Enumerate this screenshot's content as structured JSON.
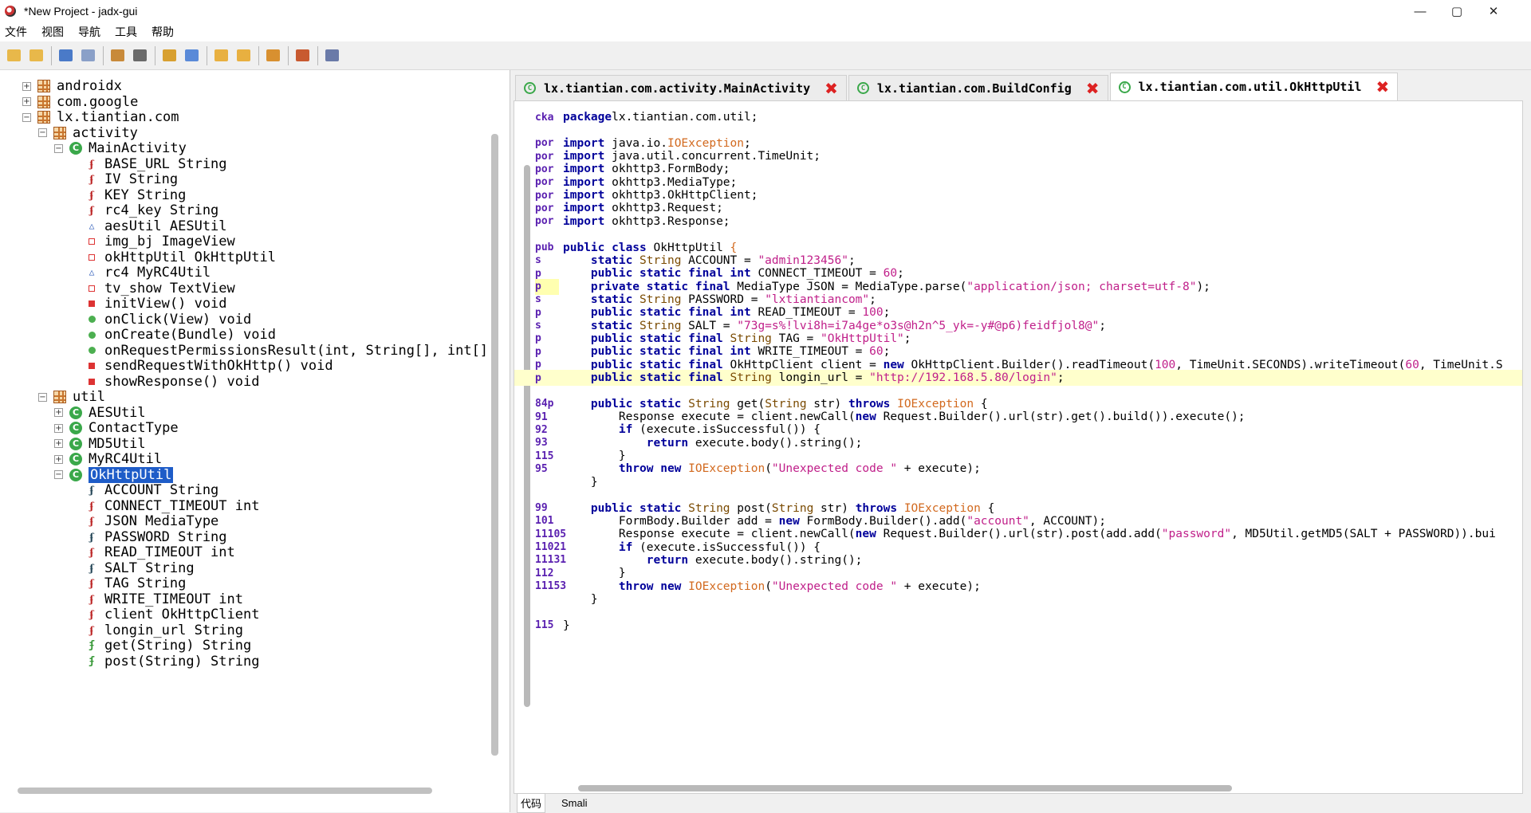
{
  "window": {
    "title": "*New Project - jadx-gui",
    "min": "—",
    "max": "▢",
    "close": "✕"
  },
  "menu": [
    "文件",
    "视图",
    "导航",
    "工具",
    "帮助"
  ],
  "toolbar": [
    {
      "name": "open-file",
      "color": "#e8b84a"
    },
    {
      "name": "add-file",
      "color": "#e8b84a"
    },
    {
      "sep": true
    },
    {
      "name": "save-all",
      "color": "#4a7ac8"
    },
    {
      "name": "export",
      "color": "#8aa0c8"
    },
    {
      "sep": true
    },
    {
      "name": "sync-tree",
      "color": "#c88a3a"
    },
    {
      "name": "flatten",
      "color": "#6a6a6a"
    },
    {
      "sep": true
    },
    {
      "name": "search-text",
      "color": "#d8a030"
    },
    {
      "name": "search-class",
      "color": "#5a8ad8"
    },
    {
      "sep": true
    },
    {
      "name": "back",
      "color": "#e8b040"
    },
    {
      "name": "forward",
      "color": "#e8b040"
    },
    {
      "sep": true
    },
    {
      "name": "decompile",
      "color": "#d89030"
    },
    {
      "sep": true
    },
    {
      "name": "log",
      "color": "#c85a30"
    },
    {
      "sep": true
    },
    {
      "name": "preferences",
      "color": "#6a7aa8"
    }
  ],
  "tree": [
    {
      "label": "androidx",
      "type": "pkg",
      "indent": 0,
      "exp": "+"
    },
    {
      "label": "com.google",
      "type": "pkg",
      "indent": 0,
      "exp": "+"
    },
    {
      "label": "lx.tiantian.com",
      "type": "pkg",
      "indent": 0,
      "exp": "−"
    },
    {
      "label": "activity",
      "type": "pkg",
      "indent": 1,
      "exp": "−"
    },
    {
      "label": "MainActivity",
      "type": "cls",
      "indent": 2,
      "exp": "−"
    },
    {
      "label": "BASE_URL String",
      "type": "fld",
      "indent": 3
    },
    {
      "label": "IV String",
      "type": "fld",
      "indent": 3
    },
    {
      "label": "KEY String",
      "type": "fld",
      "indent": 3
    },
    {
      "label": "rc4_key String",
      "type": "fld",
      "indent": 3
    },
    {
      "label": "aesUtil AESUtil",
      "type": "tri",
      "indent": 3
    },
    {
      "label": "img_bj ImageView",
      "type": "sqo",
      "indent": 3
    },
    {
      "label": "okHttpUtil OkHttpUtil",
      "type": "sqo",
      "indent": 3
    },
    {
      "label": "rc4 MyRC4Util",
      "type": "tri",
      "indent": 3
    },
    {
      "label": "tv_show TextView",
      "type": "sqo",
      "indent": 3
    },
    {
      "label": "initView() void",
      "type": "sqr",
      "indent": 3
    },
    {
      "label": "onClick(View) void",
      "type": "dot",
      "indent": 3
    },
    {
      "label": "onCreate(Bundle) void",
      "type": "dot",
      "indent": 3
    },
    {
      "label": "onRequestPermissionsResult(int, String[], int[]",
      "type": "dot",
      "indent": 3
    },
    {
      "label": "sendRequestWithOkHttp() void",
      "type": "sqr",
      "indent": 3
    },
    {
      "label": "showResponse() void",
      "type": "sqr",
      "indent": 3
    },
    {
      "label": "util",
      "type": "pkg",
      "indent": 1,
      "exp": "−"
    },
    {
      "label": "AESUtil",
      "type": "cls",
      "indent": 2,
      "exp": "+"
    },
    {
      "label": "ContactType",
      "type": "cls",
      "indent": 2,
      "exp": "+"
    },
    {
      "label": "MD5Util",
      "type": "cls",
      "indent": 2,
      "exp": "+"
    },
    {
      "label": "MyRC4Util",
      "type": "cls",
      "indent": 2,
      "exp": "+"
    },
    {
      "label": "OkHttpUtil",
      "type": "cls",
      "indent": 2,
      "exp": "−",
      "selected": true
    },
    {
      "label": "ACCOUNT String",
      "type": "fldb",
      "indent": 3
    },
    {
      "label": "CONNECT_TIMEOUT int",
      "type": "fld",
      "indent": 3
    },
    {
      "label": "JSON MediaType",
      "type": "fld",
      "indent": 3
    },
    {
      "label": "PASSWORD String",
      "type": "fldb",
      "indent": 3
    },
    {
      "label": "READ_TIMEOUT int",
      "type": "fld",
      "indent": 3
    },
    {
      "label": "SALT String",
      "type": "fldb",
      "indent": 3
    },
    {
      "label": "TAG String",
      "type": "fld",
      "indent": 3
    },
    {
      "label": "WRITE_TIMEOUT int",
      "type": "fld",
      "indent": 3
    },
    {
      "label": "client OkHttpClient",
      "type": "fld",
      "indent": 3
    },
    {
      "label": "longin_url String",
      "type": "fld",
      "indent": 3
    },
    {
      "label": "get(String) String",
      "type": "mth",
      "indent": 3
    },
    {
      "label": "post(String) String",
      "type": "mth",
      "indent": 3
    }
  ],
  "tabs": [
    {
      "label": "lx.tiantian.com.activity.MainActivity",
      "active": false
    },
    {
      "label": "lx.tiantian.com.BuildConfig",
      "active": false
    },
    {
      "label": "lx.tiantian.com.util.OkHttpUtil",
      "active": true
    }
  ],
  "code": [
    {
      "g": "cka",
      "t": [
        [
          "kw",
          "package"
        ],
        [
          "",
          "lx.tiantian.com.util;"
        ]
      ]
    },
    {
      "g": "",
      "t": []
    },
    {
      "g": "por",
      "t": [
        [
          "kw",
          "import"
        ],
        [
          "",
          " java.io."
        ],
        [
          "ex",
          "IOException"
        ],
        [
          "",
          ";"
        ]
      ]
    },
    {
      "g": "por",
      "t": [
        [
          "kw",
          "import"
        ],
        [
          "",
          " java.util.concurrent.TimeUnit;"
        ]
      ]
    },
    {
      "g": "por",
      "t": [
        [
          "kw",
          "import"
        ],
        [
          "",
          " okhttp3.FormBody;"
        ]
      ]
    },
    {
      "g": "por",
      "t": [
        [
          "kw",
          "import"
        ],
        [
          "",
          " okhttp3.MediaType;"
        ]
      ]
    },
    {
      "g": "por",
      "t": [
        [
          "kw",
          "import"
        ],
        [
          "",
          " okhttp3.OkHttpClient;"
        ]
      ]
    },
    {
      "g": "por",
      "t": [
        [
          "kw",
          "import"
        ],
        [
          "",
          " okhttp3.Request;"
        ]
      ]
    },
    {
      "g": "por",
      "t": [
        [
          "kw",
          "import"
        ],
        [
          "",
          " okhttp3.Response;"
        ]
      ]
    },
    {
      "g": "",
      "t": []
    },
    {
      "g": "pub",
      "t": [
        [
          "kw",
          "public class"
        ],
        [
          "",
          " OkHttpUtil "
        ],
        [
          "ex",
          "{"
        ]
      ]
    },
    {
      "g": "s",
      "t": [
        [
          "",
          "    "
        ],
        [
          "kw",
          "static"
        ],
        [
          "ty",
          " String"
        ],
        [
          "",
          " ACCOUNT = "
        ],
        [
          "st",
          "\"admin123456\""
        ],
        [
          "",
          ";"
        ]
      ]
    },
    {
      "g": "p",
      "t": [
        [
          "",
          "    "
        ],
        [
          "kw",
          "public static final int"
        ],
        [
          "",
          " CONNECT_TIMEOUT = "
        ],
        [
          "nm",
          "60"
        ],
        [
          "",
          ";"
        ]
      ]
    },
    {
      "g": "p",
      "mark": true,
      "t": [
        [
          "",
          "    "
        ],
        [
          "kw",
          "private static final"
        ],
        [
          "",
          " MediaType JSON = MediaType.parse("
        ],
        [
          "st",
          "\"application/json; charset=utf-8\""
        ],
        [
          "",
          ");"
        ]
      ]
    },
    {
      "g": "s",
      "t": [
        [
          "",
          "    "
        ],
        [
          "kw",
          "static"
        ],
        [
          "ty",
          " String"
        ],
        [
          "",
          " PASSWORD = "
        ],
        [
          "st",
          "\"lxtiantiancom\""
        ],
        [
          "",
          ";"
        ]
      ]
    },
    {
      "g": "p",
      "t": [
        [
          "",
          "    "
        ],
        [
          "kw",
          "public static final int"
        ],
        [
          "",
          " READ_TIMEOUT = "
        ],
        [
          "nm",
          "100"
        ],
        [
          "",
          ";"
        ]
      ]
    },
    {
      "g": "s",
      "t": [
        [
          "",
          "    "
        ],
        [
          "kw",
          "static"
        ],
        [
          "ty",
          " String"
        ],
        [
          "",
          " SALT = "
        ],
        [
          "st",
          "\"73g=s%!lvi8h=i7a4ge*o3s@h2n^5_yk=-y#@p6)feidfjol8@\""
        ],
        [
          "",
          ";"
        ]
      ]
    },
    {
      "g": "p",
      "t": [
        [
          "",
          "    "
        ],
        [
          "kw",
          "public static final"
        ],
        [
          "ty",
          " String"
        ],
        [
          "",
          " TAG = "
        ],
        [
          "st",
          "\"OkHttpUtil\""
        ],
        [
          "",
          ";"
        ]
      ]
    },
    {
      "g": "p",
      "t": [
        [
          "",
          "    "
        ],
        [
          "kw",
          "public static final int"
        ],
        [
          "",
          " WRITE_TIMEOUT = "
        ],
        [
          "nm",
          "60"
        ],
        [
          "",
          ";"
        ]
      ]
    },
    {
      "g": "p",
      "t": [
        [
          "",
          "    "
        ],
        [
          "kw",
          "public static final"
        ],
        [
          "",
          " OkHttpClient client = "
        ],
        [
          "kw",
          "new"
        ],
        [
          "",
          " OkHttpClient.Builder().readTimeout("
        ],
        [
          "nm",
          "100"
        ],
        [
          "",
          ", TimeUnit.SECONDS).writeTimeout("
        ],
        [
          "nm",
          "60"
        ],
        [
          "",
          ", TimeUnit.S"
        ]
      ]
    },
    {
      "g": "p",
      "hl": true,
      "t": [
        [
          "",
          "    "
        ],
        [
          "kw",
          "public static final"
        ],
        [
          "ty",
          " String"
        ],
        [
          "",
          " longin_url = "
        ],
        [
          "st",
          "\"http://192.168.5.80/login\""
        ],
        [
          "",
          ";"
        ]
      ]
    },
    {
      "g": "",
      "t": []
    },
    {
      "g": "84p",
      "t": [
        [
          "",
          "    "
        ],
        [
          "kw",
          "public static"
        ],
        [
          "ty",
          " String"
        ],
        [
          "",
          " get("
        ],
        [
          "ty",
          "String"
        ],
        [
          "",
          " str) "
        ],
        [
          "kw",
          "throws"
        ],
        [
          "ex",
          " IOException"
        ],
        [
          "",
          " {"
        ]
      ]
    },
    {
      "g": "91",
      "t": [
        [
          "",
          "        Response execute = client.newCall("
        ],
        [
          "kw",
          "new"
        ],
        [
          "",
          " Request.Builder().url(str).get().build()).execute();"
        ]
      ]
    },
    {
      "g": "92",
      "t": [
        [
          "",
          "        "
        ],
        [
          "kw",
          "if"
        ],
        [
          "",
          " (execute.isSuccessful()) {"
        ]
      ]
    },
    {
      "g": "93",
      "t": [
        [
          "",
          "            "
        ],
        [
          "kw",
          "return"
        ],
        [
          "",
          " execute.body().string();"
        ]
      ]
    },
    {
      "g": "115",
      "t": [
        [
          "",
          "        }"
        ]
      ]
    },
    {
      "g": "95",
      "t": [
        [
          "",
          "        "
        ],
        [
          "kw",
          "throw new"
        ],
        [
          "ex",
          " IOException"
        ],
        [
          "",
          "("
        ],
        [
          "st",
          "\"Unexpected code \""
        ],
        [
          "",
          " + execute);"
        ]
      ]
    },
    {
      "g": "",
      "t": [
        [
          "",
          "    }"
        ]
      ]
    },
    {
      "g": "",
      "t": []
    },
    {
      "g": "99",
      "t": [
        [
          "",
          "    "
        ],
        [
          "kw",
          "public static"
        ],
        [
          "ty",
          " String"
        ],
        [
          "",
          " post("
        ],
        [
          "ty",
          "String"
        ],
        [
          "",
          " str) "
        ],
        [
          "kw",
          "throws"
        ],
        [
          "ex",
          " IOException"
        ],
        [
          "",
          " {"
        ]
      ]
    },
    {
      "g": "101",
      "t": [
        [
          "",
          "        FormBody.Builder add = "
        ],
        [
          "kw",
          "new"
        ],
        [
          "",
          " FormBody.Builder().add("
        ],
        [
          "st",
          "\"account\""
        ],
        [
          "",
          ", ACCOUNT);"
        ]
      ]
    },
    {
      "g": "11105",
      "t": [
        [
          "",
          "        Response execute = client.newCall("
        ],
        [
          "kw",
          "new"
        ],
        [
          "",
          " Request.Builder().url(str).post(add.add("
        ],
        [
          "st",
          "\"password\""
        ],
        [
          "",
          ", MD5Util.getMD5(SALT + PASSWORD)).bui"
        ]
      ]
    },
    {
      "g": "11021",
      "t": [
        [
          "",
          "        "
        ],
        [
          "kw",
          "if"
        ],
        [
          "",
          " (execute.isSuccessful()) {"
        ]
      ]
    },
    {
      "g": "11131",
      "t": [
        [
          "",
          "            "
        ],
        [
          "kw",
          "return"
        ],
        [
          "",
          " execute.body().string();"
        ]
      ]
    },
    {
      "g": "112",
      "t": [
        [
          "",
          "        }"
        ]
      ]
    },
    {
      "g": "11153",
      "t": [
        [
          "",
          "        "
        ],
        [
          "kw",
          "throw new"
        ],
        [
          "ex",
          " IOException"
        ],
        [
          "",
          "("
        ],
        [
          "st",
          "\"Unexpected code \""
        ],
        [
          "",
          " + execute);"
        ]
      ]
    },
    {
      "g": "",
      "t": [
        [
          "",
          "    }"
        ]
      ]
    },
    {
      "g": "",
      "t": []
    },
    {
      "g": "115",
      "t": [
        [
          "",
          "}"
        ]
      ]
    }
  ],
  "bottom_tabs": [
    "代码",
    "Smali"
  ]
}
